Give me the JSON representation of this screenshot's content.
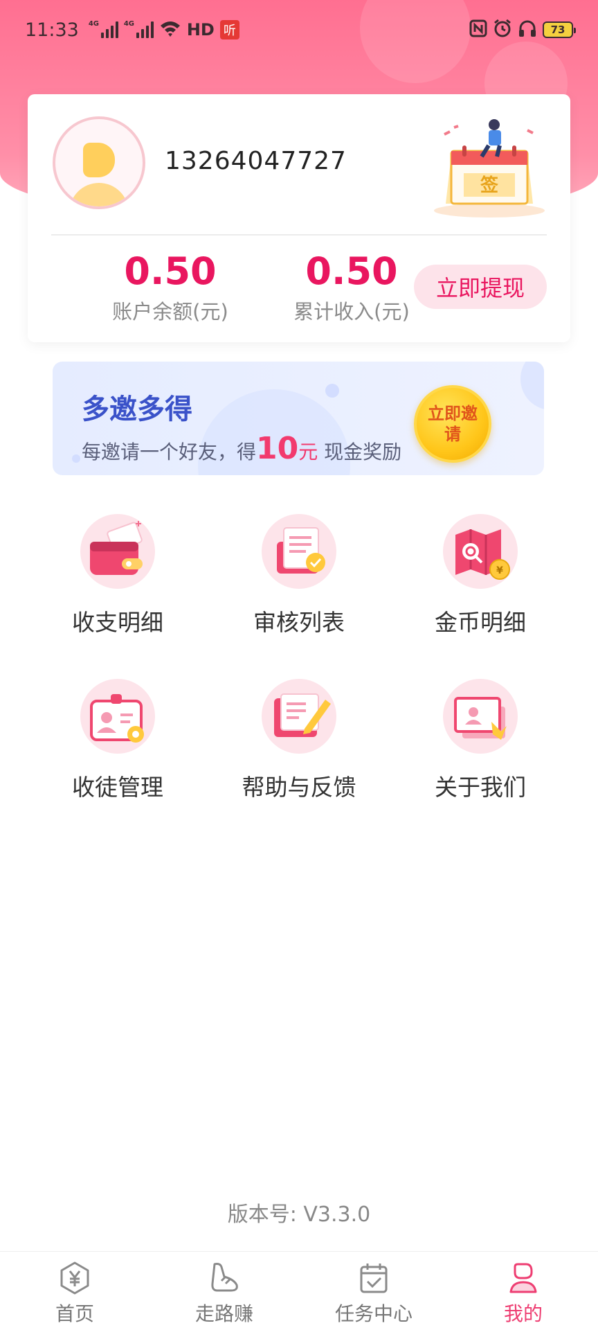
{
  "status_bar": {
    "time": "11:33",
    "network_1": "4G",
    "network_2": "4G",
    "hd_label": "HD",
    "app_badge": "听",
    "battery": "73"
  },
  "profile": {
    "phone": "13264047727",
    "balance_value": "0.50",
    "balance_label": "账户余额(元)",
    "income_value": "0.50",
    "income_label": "累计收入(元)",
    "withdraw_label": "立即提现",
    "sign_icon_text": "签"
  },
  "invite": {
    "title": "多邀多得",
    "subtitle_prefix": "每邀请一个好友，得",
    "amount": "10",
    "amount_unit": "元",
    "subtitle_suffix": "现金奖励",
    "button_label": "立即邀请"
  },
  "menu": [
    {
      "label": "收支明细",
      "icon": "wallet-icon"
    },
    {
      "label": "审核列表",
      "icon": "review-list-icon"
    },
    {
      "label": "金币明细",
      "icon": "coin-map-icon"
    },
    {
      "label": "收徒管理",
      "icon": "apprentice-card-icon"
    },
    {
      "label": "帮助与反馈",
      "icon": "feedback-edit-icon"
    },
    {
      "label": "关于我们",
      "icon": "about-us-icon"
    }
  ],
  "version_text": "版本号: V3.3.0",
  "bottom_nav": [
    {
      "label": "首页",
      "icon": "yuan-hexagon-icon",
      "active": false
    },
    {
      "label": "走路赚",
      "icon": "shoe-icon",
      "active": false
    },
    {
      "label": "任务中心",
      "icon": "calendar-check-icon",
      "active": false
    },
    {
      "label": "我的",
      "icon": "user-icon",
      "active": true
    }
  ],
  "colors": {
    "brand_pink": "#e9165f",
    "header_gradient_top": "#ff6f91",
    "invite_title": "#3a52c9",
    "nav_active": "#ee3e72"
  }
}
